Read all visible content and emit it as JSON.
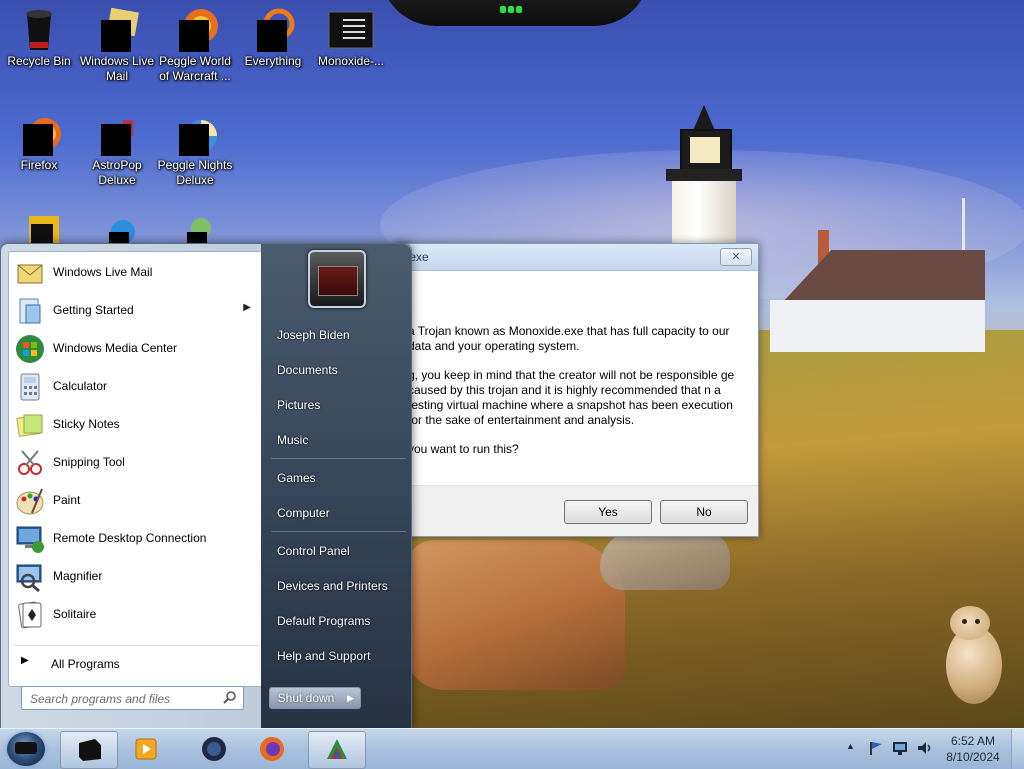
{
  "desktop": {
    "icons": [
      {
        "label": "Recycle Bin"
      },
      {
        "label": "Windows Live Mail"
      },
      {
        "label": "Peggle World of Warcraft ..."
      },
      {
        "label": "Everything"
      },
      {
        "label": "Monoxide-..."
      },
      {
        "label": "Firefox"
      },
      {
        "label": "AstroPop Deluxe"
      },
      {
        "label": "Peggle Nights Deluxe"
      }
    ]
  },
  "dialog": {
    "title": ".exe",
    "close_glyph": "✕",
    "paragraphs": [
      "a Trojan known as Monoxide.exe that has full capacity to our data and your operating system.",
      "g, you keep in mind that the creator will not be responsible ge caused by this trojan and it is highly recommended that n a testing virtual machine where a snapshot has been execution for the sake of entertainment and analysis.",
      "you want to run this?"
    ],
    "yes_label": "Yes",
    "no_label": "No"
  },
  "start_menu": {
    "programs": [
      {
        "label": "Windows Live Mail",
        "icon": "mail-icon"
      },
      {
        "label": "Getting Started",
        "icon": "getting-started-icon",
        "submenu": true
      },
      {
        "label": "Windows Media Center",
        "icon": "media-center-icon"
      },
      {
        "label": "Calculator",
        "icon": "calculator-icon"
      },
      {
        "label": "Sticky Notes",
        "icon": "sticky-notes-icon"
      },
      {
        "label": "Snipping Tool",
        "icon": "snipping-tool-icon"
      },
      {
        "label": "Paint",
        "icon": "paint-icon"
      },
      {
        "label": "Remote Desktop Connection",
        "icon": "remote-desktop-icon"
      },
      {
        "label": "Magnifier",
        "icon": "magnifier-icon"
      },
      {
        "label": "Solitaire",
        "icon": "solitaire-icon"
      }
    ],
    "submenu_arrow": "▶",
    "all_programs": "All Programs",
    "all_programs_arrow": "▶",
    "search_placeholder": "Search programs and files",
    "user": "Joseph Biden",
    "right_links": [
      "Documents",
      "Pictures",
      "Music",
      "Games",
      "Computer",
      "Control Panel",
      "Devices and Printers",
      "Default Programs",
      "Help and Support"
    ],
    "shutdown_label": "Shut down",
    "shutdown_arrow": "▶"
  },
  "taskbar": {
    "tray_up": "▲",
    "time": "6:52 AM",
    "date": "8/10/2024"
  },
  "colors": {
    "taskbar": "#a9c1de",
    "start_right_pane": "#2c3a4b",
    "dialog_border": "#7f9db9"
  }
}
